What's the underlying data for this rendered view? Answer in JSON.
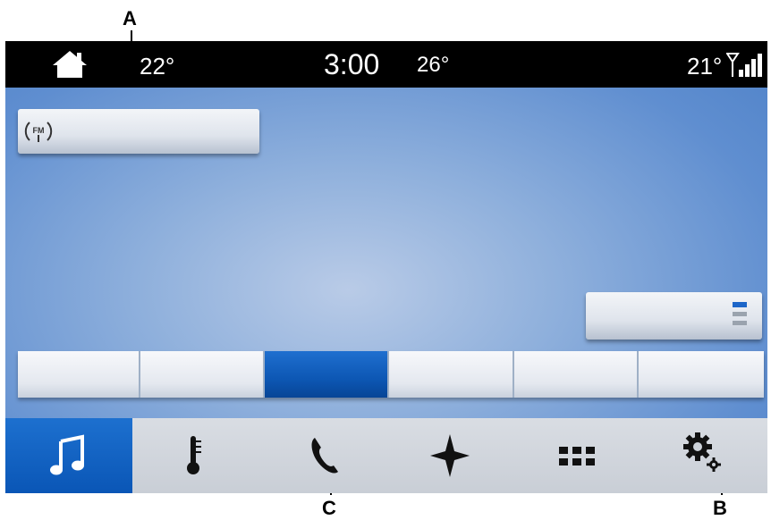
{
  "callouts": {
    "a": "A",
    "b": "B",
    "c": "C"
  },
  "status_bar": {
    "home_icon": "home-icon",
    "temp_left": "22°",
    "clock": "3:00",
    "temp_mid": "26°",
    "temp_right": "21°",
    "signal_icon": "signal-strength-icon"
  },
  "source_button": {
    "icon": "fm-radio-icon"
  },
  "list_button": {
    "icon": "list-icon"
  },
  "presets": {
    "count": 6,
    "active_index": 2
  },
  "nav": {
    "items": [
      {
        "icon": "music-note-icon",
        "active": true
      },
      {
        "icon": "thermometer-icon",
        "active": false
      },
      {
        "icon": "phone-icon",
        "active": false
      },
      {
        "icon": "navigation-star-icon",
        "active": false
      },
      {
        "icon": "apps-grid-icon",
        "active": false
      },
      {
        "icon": "settings-gear-icon",
        "active": false
      }
    ]
  },
  "colors": {
    "accent_blue": "#0d57b4",
    "background_blue": "#6f98d4",
    "status_bar": "#000000",
    "nav_bar": "#d2d6dc"
  }
}
